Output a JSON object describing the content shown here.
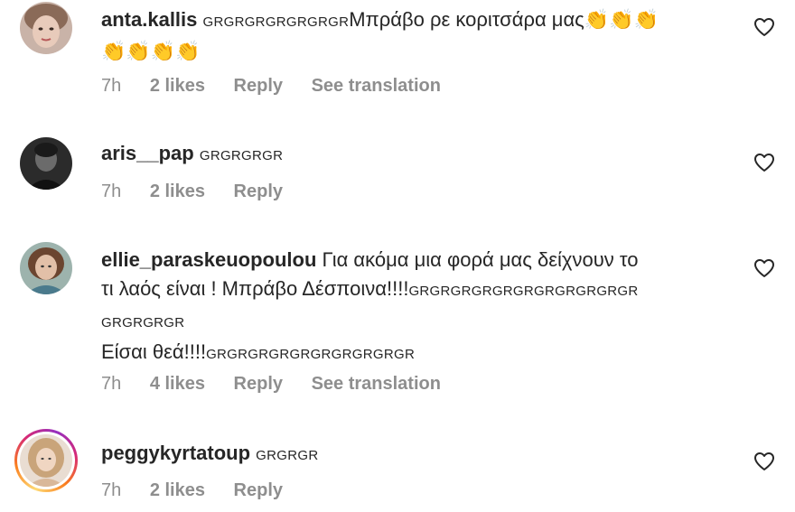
{
  "comments": [
    {
      "username": "anta.kallis",
      "tag": "GRGRGRGRGRGRGR",
      "text_line1": "Μπράβο ρε κοριτσάρα μας",
      "emojis_line1": "👏👏👏",
      "emojis_line2": "👏👏👏👏",
      "time": "7h",
      "likes": "2 likes",
      "reply": "Reply",
      "translate": "See translation"
    },
    {
      "username": "aris__pap",
      "tag": "GRGRGRGR",
      "time": "7h",
      "likes": "2 likes",
      "reply": "Reply"
    },
    {
      "username": "ellie_paraskeuopoulou",
      "text_line1": "Για ακόμα μια φορά μας δείχνουν το",
      "text_line2": "τι λαός είναι ! Μπράβο Δέσποινα!!!!",
      "tag_line2": "GRGRGRGRGRGRGRGRGRGRGR",
      "tag_line3": "GRGRGRGR",
      "text_line4": "Είσαι θεά!!!!",
      "tag_line4": "GRGRGRGRGRGRGRGRGRGR",
      "time": "7h",
      "likes": "4 likes",
      "reply": "Reply",
      "translate": "See translation"
    },
    {
      "username": "peggykyrtatoup",
      "tag": "GRGRGR",
      "time": "7h",
      "likes": "2 likes",
      "reply": "Reply"
    }
  ],
  "colors": {
    "text": "#262626",
    "meta": "#8e8e8e"
  },
  "icons": {
    "like": "heart-outline-icon"
  }
}
